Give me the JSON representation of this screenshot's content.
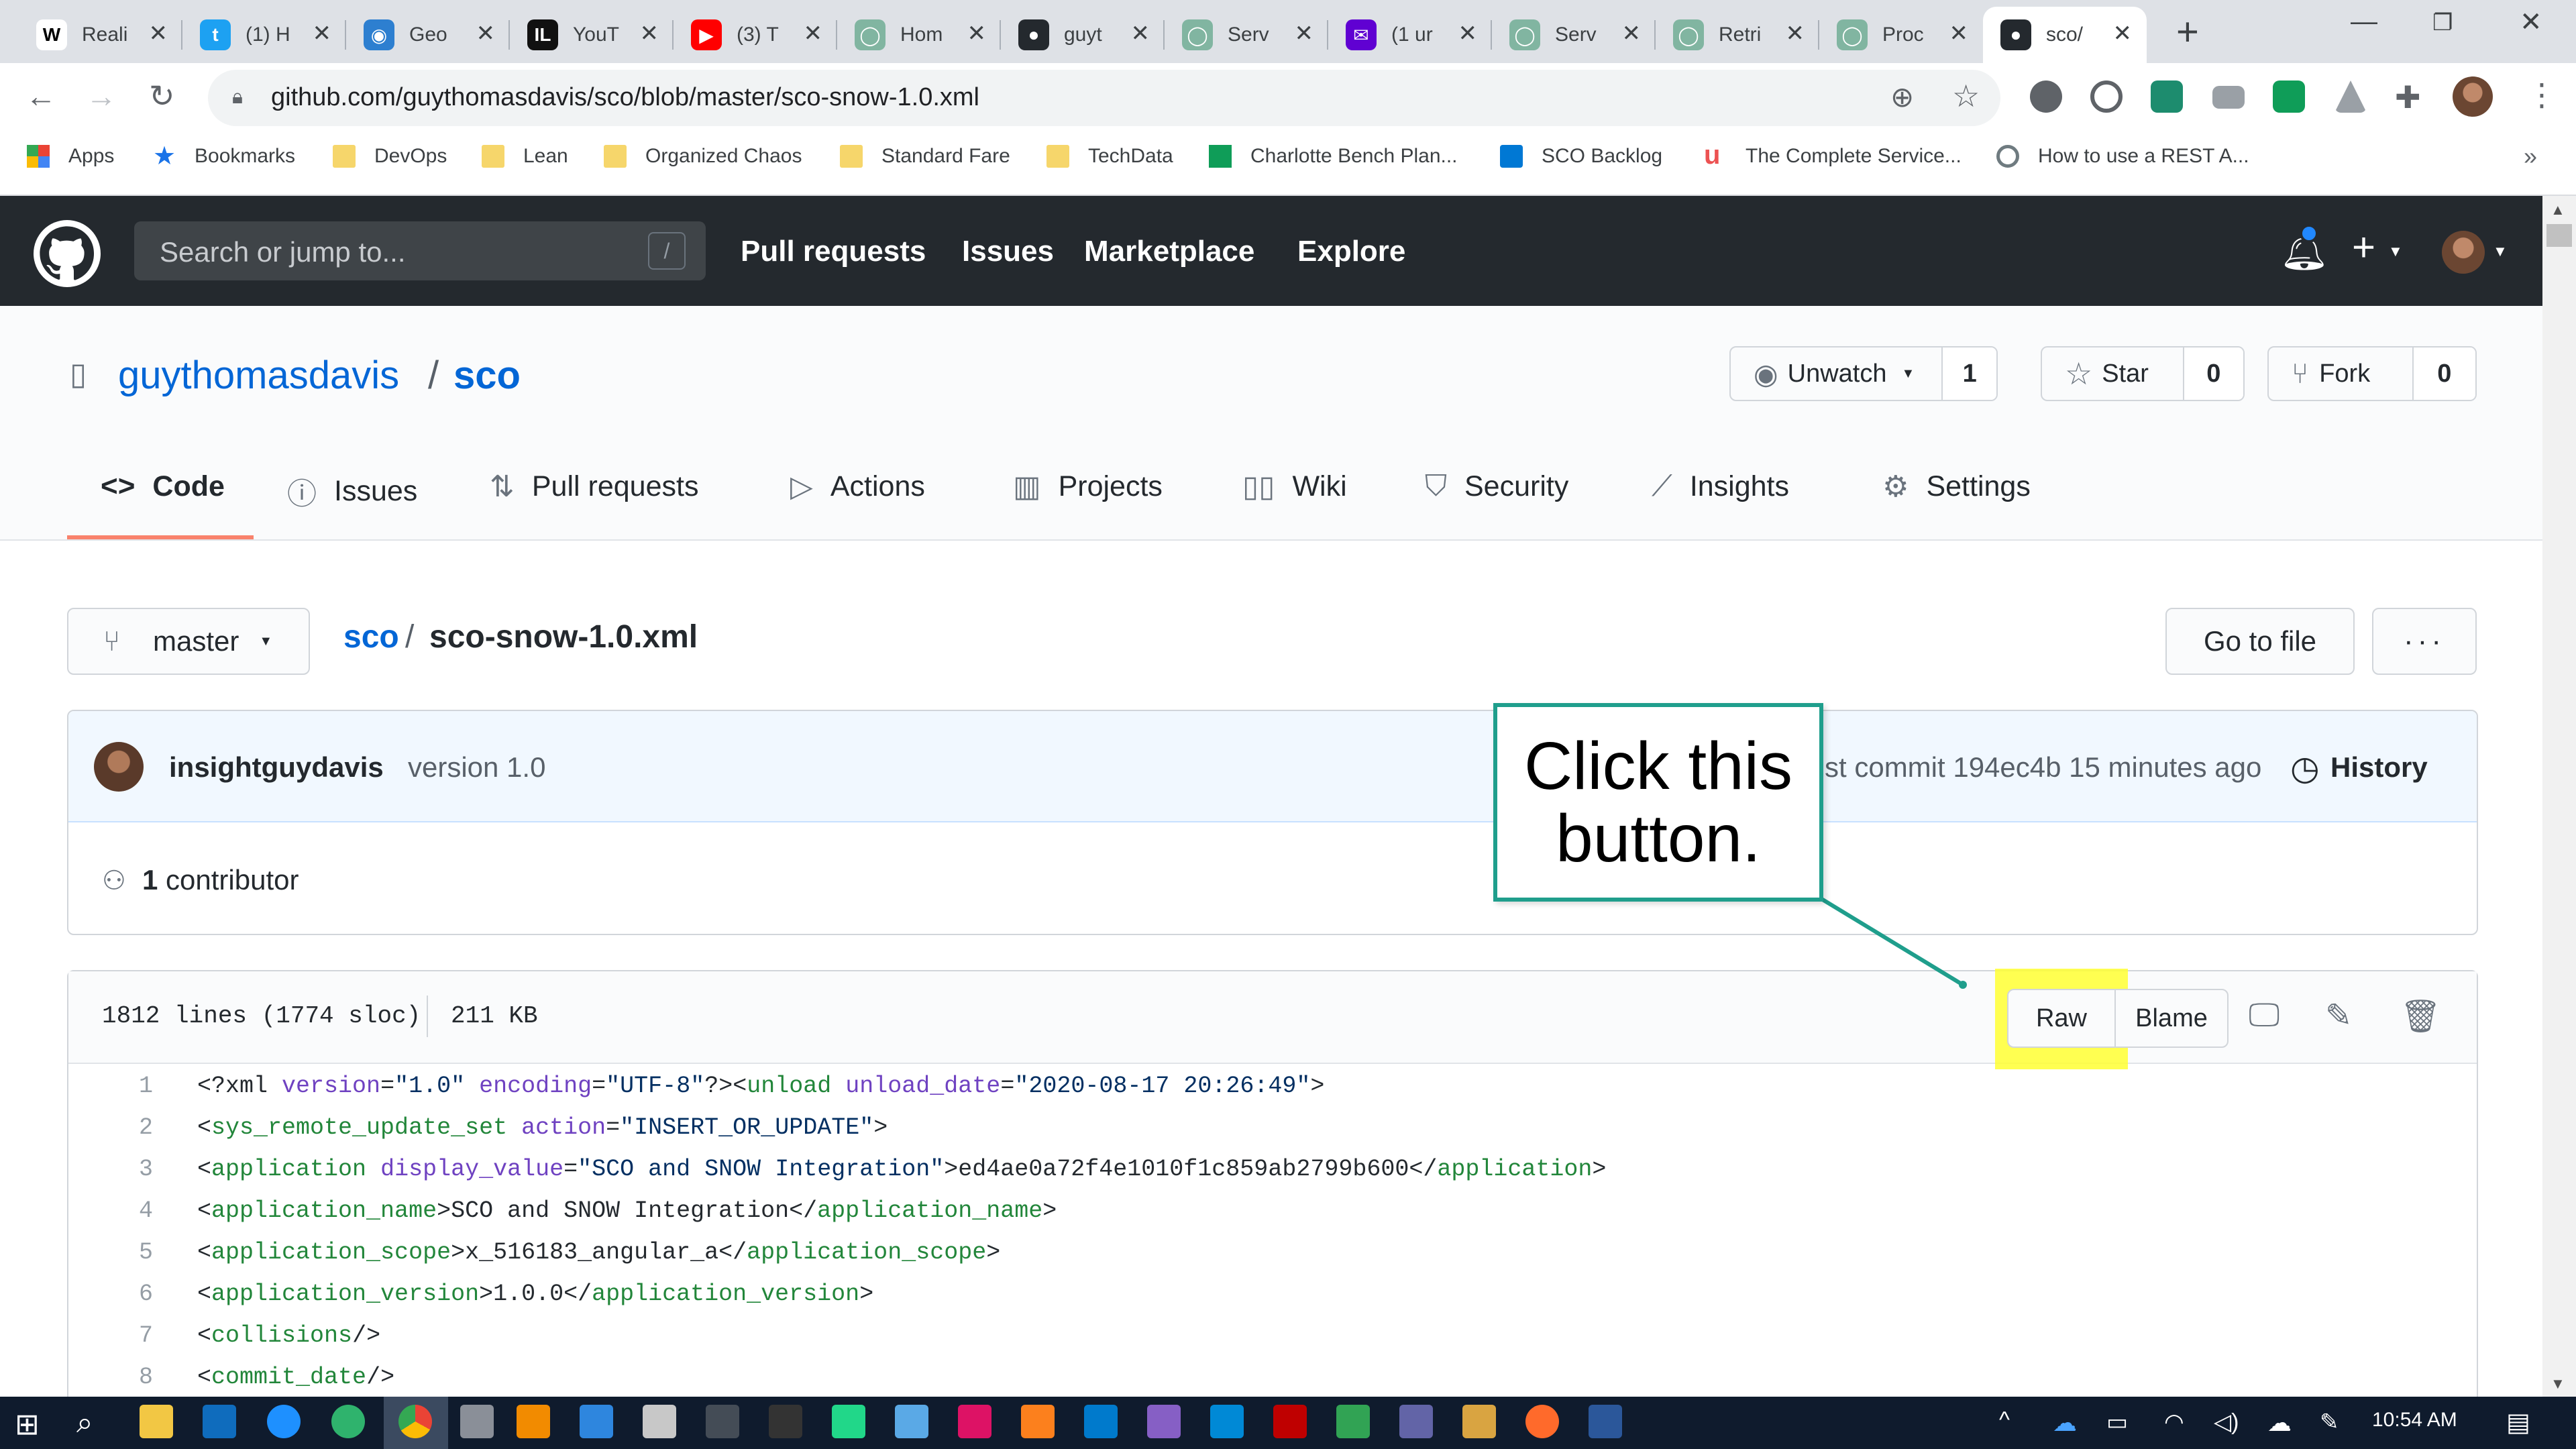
{
  "browser": {
    "tabs": [
      {
        "title": "Reali",
        "icon": "wikipedia-icon",
        "color": "#ffffff",
        "fg": "#000000",
        "glyph": "W"
      },
      {
        "title": "(1) H",
        "icon": "twitter-icon",
        "color": "#1da1f2",
        "fg": "#ffffff",
        "glyph": "t"
      },
      {
        "title": "Geo",
        "icon": "geocaching-icon",
        "color": "#2d7fd0",
        "fg": "#ffffff",
        "glyph": "◉"
      },
      {
        "title": "YouT",
        "icon": "il-icon",
        "color": "#111111",
        "fg": "#ffffff",
        "glyph": "IL"
      },
      {
        "title": "(3) T",
        "icon": "youtube-icon",
        "color": "#ff0000",
        "fg": "#ffffff",
        "glyph": "▶"
      },
      {
        "title": "Hom",
        "icon": "servicenow-icon",
        "color": "#81b5a1",
        "fg": "#ffffff",
        "glyph": "◯"
      },
      {
        "title": "guyt",
        "icon": "github-icon",
        "color": "#24292e",
        "fg": "#ffffff",
        "glyph": "●"
      },
      {
        "title": "Serv",
        "icon": "servicenow-icon",
        "color": "#81b5a1",
        "fg": "#ffffff",
        "glyph": "◯"
      },
      {
        "title": "(1 ur",
        "icon": "yahoo-mail-icon",
        "color": "#6001d2",
        "fg": "#ffffff",
        "glyph": "✉"
      },
      {
        "title": "Serv",
        "icon": "servicenow-icon",
        "color": "#81b5a1",
        "fg": "#ffffff",
        "glyph": "◯"
      },
      {
        "title": "Retri",
        "icon": "servicenow-icon",
        "color": "#81b5a1",
        "fg": "#ffffff",
        "glyph": "◯"
      },
      {
        "title": "Proc",
        "icon": "servicenow-icon",
        "color": "#81b5a1",
        "fg": "#ffffff",
        "glyph": "◯"
      },
      {
        "title": "sco/",
        "icon": "github-icon",
        "color": "#24292e",
        "fg": "#ffffff",
        "glyph": "●"
      }
    ],
    "url": "github.com/guythomasdavis/sco/blob/master/sco-snow-1.0.xml",
    "bookmarks": [
      {
        "label": "Apps",
        "icon": "apps-grid-icon"
      },
      {
        "label": "Bookmarks",
        "icon": "star-icon"
      },
      {
        "label": "DevOps",
        "icon": "folder-icon"
      },
      {
        "label": "Lean",
        "icon": "folder-icon"
      },
      {
        "label": "Organized Chaos",
        "icon": "folder-icon"
      },
      {
        "label": "Standard Fare",
        "icon": "folder-icon"
      },
      {
        "label": "TechData",
        "icon": "folder-icon"
      },
      {
        "label": "Charlotte Bench Plan...",
        "icon": "sheets-icon"
      },
      {
        "label": "SCO Backlog",
        "icon": "azure-devops-icon"
      },
      {
        "label": "The Complete Service...",
        "icon": "udemy-icon"
      },
      {
        "label": "How to use a REST A...",
        "icon": "servicenow-icon"
      }
    ],
    "bookmarks_overflow": "»"
  },
  "github": {
    "search_placeholder": "Search or jump to...",
    "search_key": "/",
    "nav": [
      "Pull requests",
      "Issues",
      "Marketplace",
      "Explore"
    ],
    "repo": {
      "owner": "guythomasdavis",
      "separator": "/",
      "name": "sco",
      "unwatch_label": "Unwatch",
      "unwatch_count": "1",
      "star_label": "Star",
      "star_count": "0",
      "fork_label": "Fork",
      "fork_count": "0"
    },
    "tabs": [
      {
        "label": "Code",
        "icon": "code-icon"
      },
      {
        "label": "Issues",
        "icon": "issue-icon"
      },
      {
        "label": "Pull requests",
        "icon": "pull-request-icon"
      },
      {
        "label": "Actions",
        "icon": "play-icon"
      },
      {
        "label": "Projects",
        "icon": "project-icon"
      },
      {
        "label": "Wiki",
        "icon": "book-icon"
      },
      {
        "label": "Security",
        "icon": "shield-icon"
      },
      {
        "label": "Insights",
        "icon": "graph-icon"
      },
      {
        "label": "Settings",
        "icon": "gear-icon"
      }
    ],
    "file": {
      "branch": "master",
      "path_repo": "sco",
      "path_sep": "/",
      "path_file": "sco-snow-1.0.xml",
      "goto_label": "Go to file",
      "more_label": "···",
      "commit_author": "insightguydavis",
      "commit_message": "version 1.0",
      "latest_commit": "st commit 194ec4b 15 minutes ago",
      "history_label": "History",
      "contributors_count": "1",
      "contributors_label": "contributor",
      "lines_info": "1812 lines (1774 sloc)",
      "size": "211 KB",
      "raw_label": "Raw",
      "blame_label": "Blame"
    },
    "code_lines": [
      {
        "n": "1",
        "parts": [
          [
            "t",
            "<?xml "
          ],
          [
            "a",
            "version"
          ],
          [
            "t",
            "="
          ],
          [
            "s",
            "\"1.0\""
          ],
          [
            "t",
            " "
          ],
          [
            "a",
            "encoding"
          ],
          [
            "t",
            "="
          ],
          [
            "s",
            "\"UTF-8\""
          ],
          [
            "t",
            "?><"
          ],
          [
            "g",
            "unload"
          ],
          [
            "t",
            " "
          ],
          [
            "a",
            "unload_date"
          ],
          [
            "t",
            "="
          ],
          [
            "s",
            "\"2020-08-17 20:26:49\""
          ],
          [
            "t",
            ">"
          ]
        ]
      },
      {
        "n": "2",
        "parts": [
          [
            "t",
            "<"
          ],
          [
            "g",
            "sys_remote_update_set"
          ],
          [
            "t",
            " "
          ],
          [
            "a",
            "action"
          ],
          [
            "t",
            "="
          ],
          [
            "s",
            "\"INSERT_OR_UPDATE\""
          ],
          [
            "t",
            ">"
          ]
        ]
      },
      {
        "n": "3",
        "parts": [
          [
            "t",
            "<"
          ],
          [
            "g",
            "application"
          ],
          [
            "t",
            " "
          ],
          [
            "a",
            "display_value"
          ],
          [
            "t",
            "="
          ],
          [
            "s",
            "\"SCO and SNOW Integration\""
          ],
          [
            "t",
            ">ed4ae0a72f4e1010f1c859ab2799b600</"
          ],
          [
            "g",
            "application"
          ],
          [
            "t",
            ">"
          ]
        ]
      },
      {
        "n": "4",
        "parts": [
          [
            "t",
            "<"
          ],
          [
            "g",
            "application_name"
          ],
          [
            "t",
            ">SCO and SNOW Integration</"
          ],
          [
            "g",
            "application_name"
          ],
          [
            "t",
            ">"
          ]
        ]
      },
      {
        "n": "5",
        "parts": [
          [
            "t",
            "<"
          ],
          [
            "g",
            "application_scope"
          ],
          [
            "t",
            ">x_516183_angular_a</"
          ],
          [
            "g",
            "application_scope"
          ],
          [
            "t",
            ">"
          ]
        ]
      },
      {
        "n": "6",
        "parts": [
          [
            "t",
            "<"
          ],
          [
            "g",
            "application_version"
          ],
          [
            "t",
            ">1.0.0</"
          ],
          [
            "g",
            "application_version"
          ],
          [
            "t",
            ">"
          ]
        ]
      },
      {
        "n": "7",
        "parts": [
          [
            "t",
            "<"
          ],
          [
            "g",
            "collisions"
          ],
          [
            "t",
            "/>"
          ]
        ]
      },
      {
        "n": "8",
        "parts": [
          [
            "t",
            "<"
          ],
          [
            "g",
            "commit_date"
          ],
          [
            "t",
            "/>"
          ]
        ]
      }
    ]
  },
  "callout": {
    "line1": "Click this",
    "line2": "button.",
    "color": "#1f9e8c"
  },
  "highlight_color": "#ffff33",
  "taskbar": {
    "clock": "10:54 AM"
  }
}
